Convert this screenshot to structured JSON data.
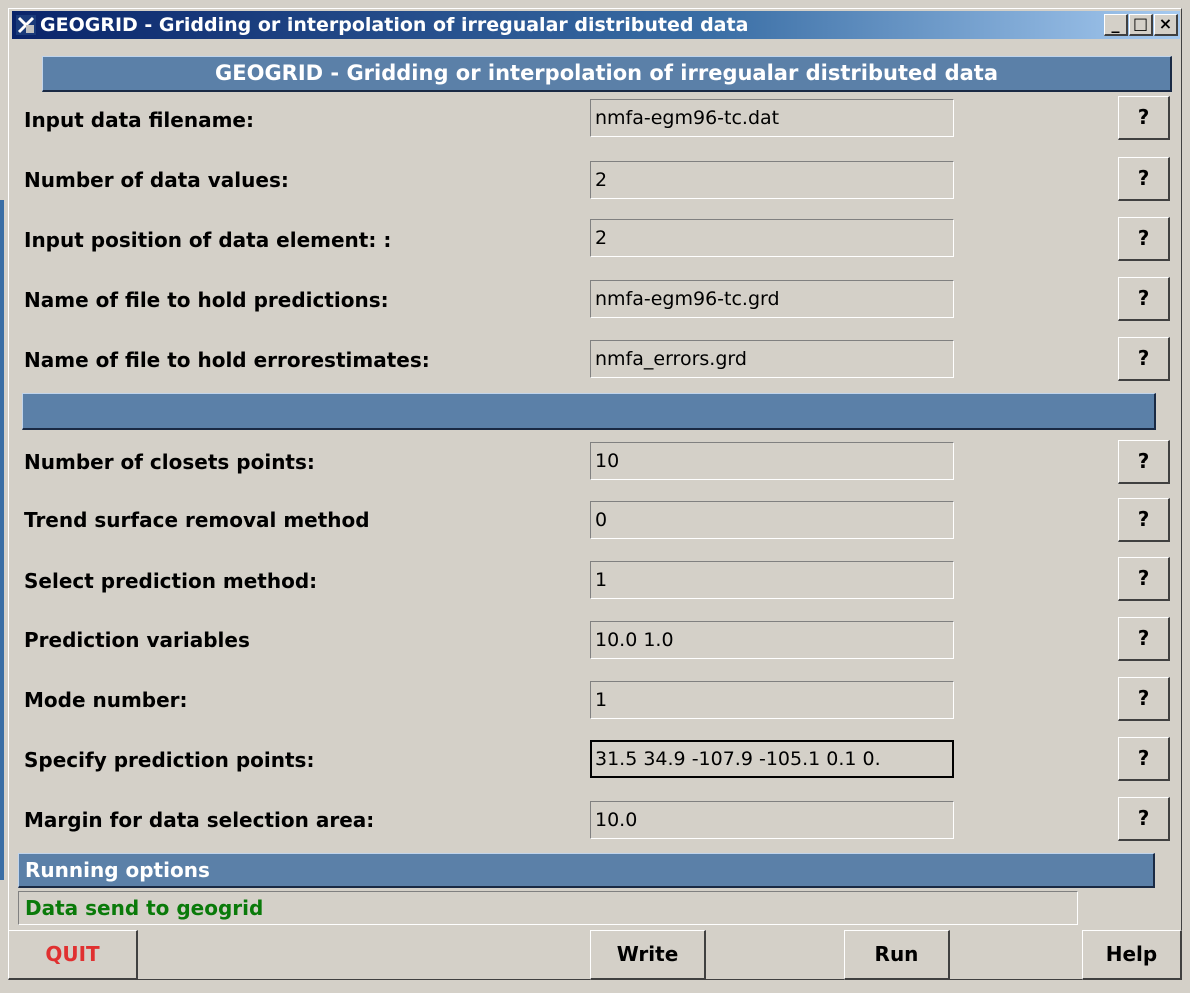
{
  "window": {
    "title": "GEOGRID - Gridding or interpolation of irregualar distributed data",
    "buttons": {
      "minimize": "_",
      "maximize": "□",
      "close": "×"
    }
  },
  "header": {
    "title": "GEOGRID - Gridding or interpolation of irregualar distributed data"
  },
  "fields": [
    {
      "label": "Input data filename:",
      "value": "nmfa-egm96-tc.dat",
      "help": "?"
    },
    {
      "label": "Number of data values:",
      "value": "2",
      "help": "?"
    },
    {
      "label": "Input position of data element: :",
      "value": "2",
      "help": "?"
    },
    {
      "label": "Name of file to hold predictions:",
      "value": "nmfa-egm96-tc.grd",
      "help": "?"
    },
    {
      "label": "Name of file to hold errorestimates:",
      "value": "nmfa_errors.grd",
      "help": "?"
    },
    {
      "label": "Number of closets points:",
      "value": "10",
      "help": "?"
    },
    {
      "label": "Trend surface removal method",
      "value": "0",
      "help": "?"
    },
    {
      "label": "Select prediction method:",
      "value": "1",
      "help": "?"
    },
    {
      "label": "Prediction variables",
      "value": "10.0 1.0",
      "help": "?"
    },
    {
      "label": "Mode  number:",
      "value": "1",
      "help": "?"
    },
    {
      "label": "Specify prediction points:",
      "value": "31.5 34.9 -107.9 -105.1  0.1  0.",
      "help": "?"
    },
    {
      "label": "Margin for data selection area:",
      "value": "10.0",
      "help": "?"
    }
  ],
  "running": {
    "title": "Running options"
  },
  "status": {
    "text": "Data send to geogrid"
  },
  "buttons": {
    "quit": "QUIT",
    "write": "Write",
    "run": "Run",
    "help": "Help"
  },
  "colors": {
    "quit_text": "#e03030",
    "status_text": "#0a7a0a",
    "header_bg": "#5b80a8",
    "title_bg": "#0a246a"
  }
}
